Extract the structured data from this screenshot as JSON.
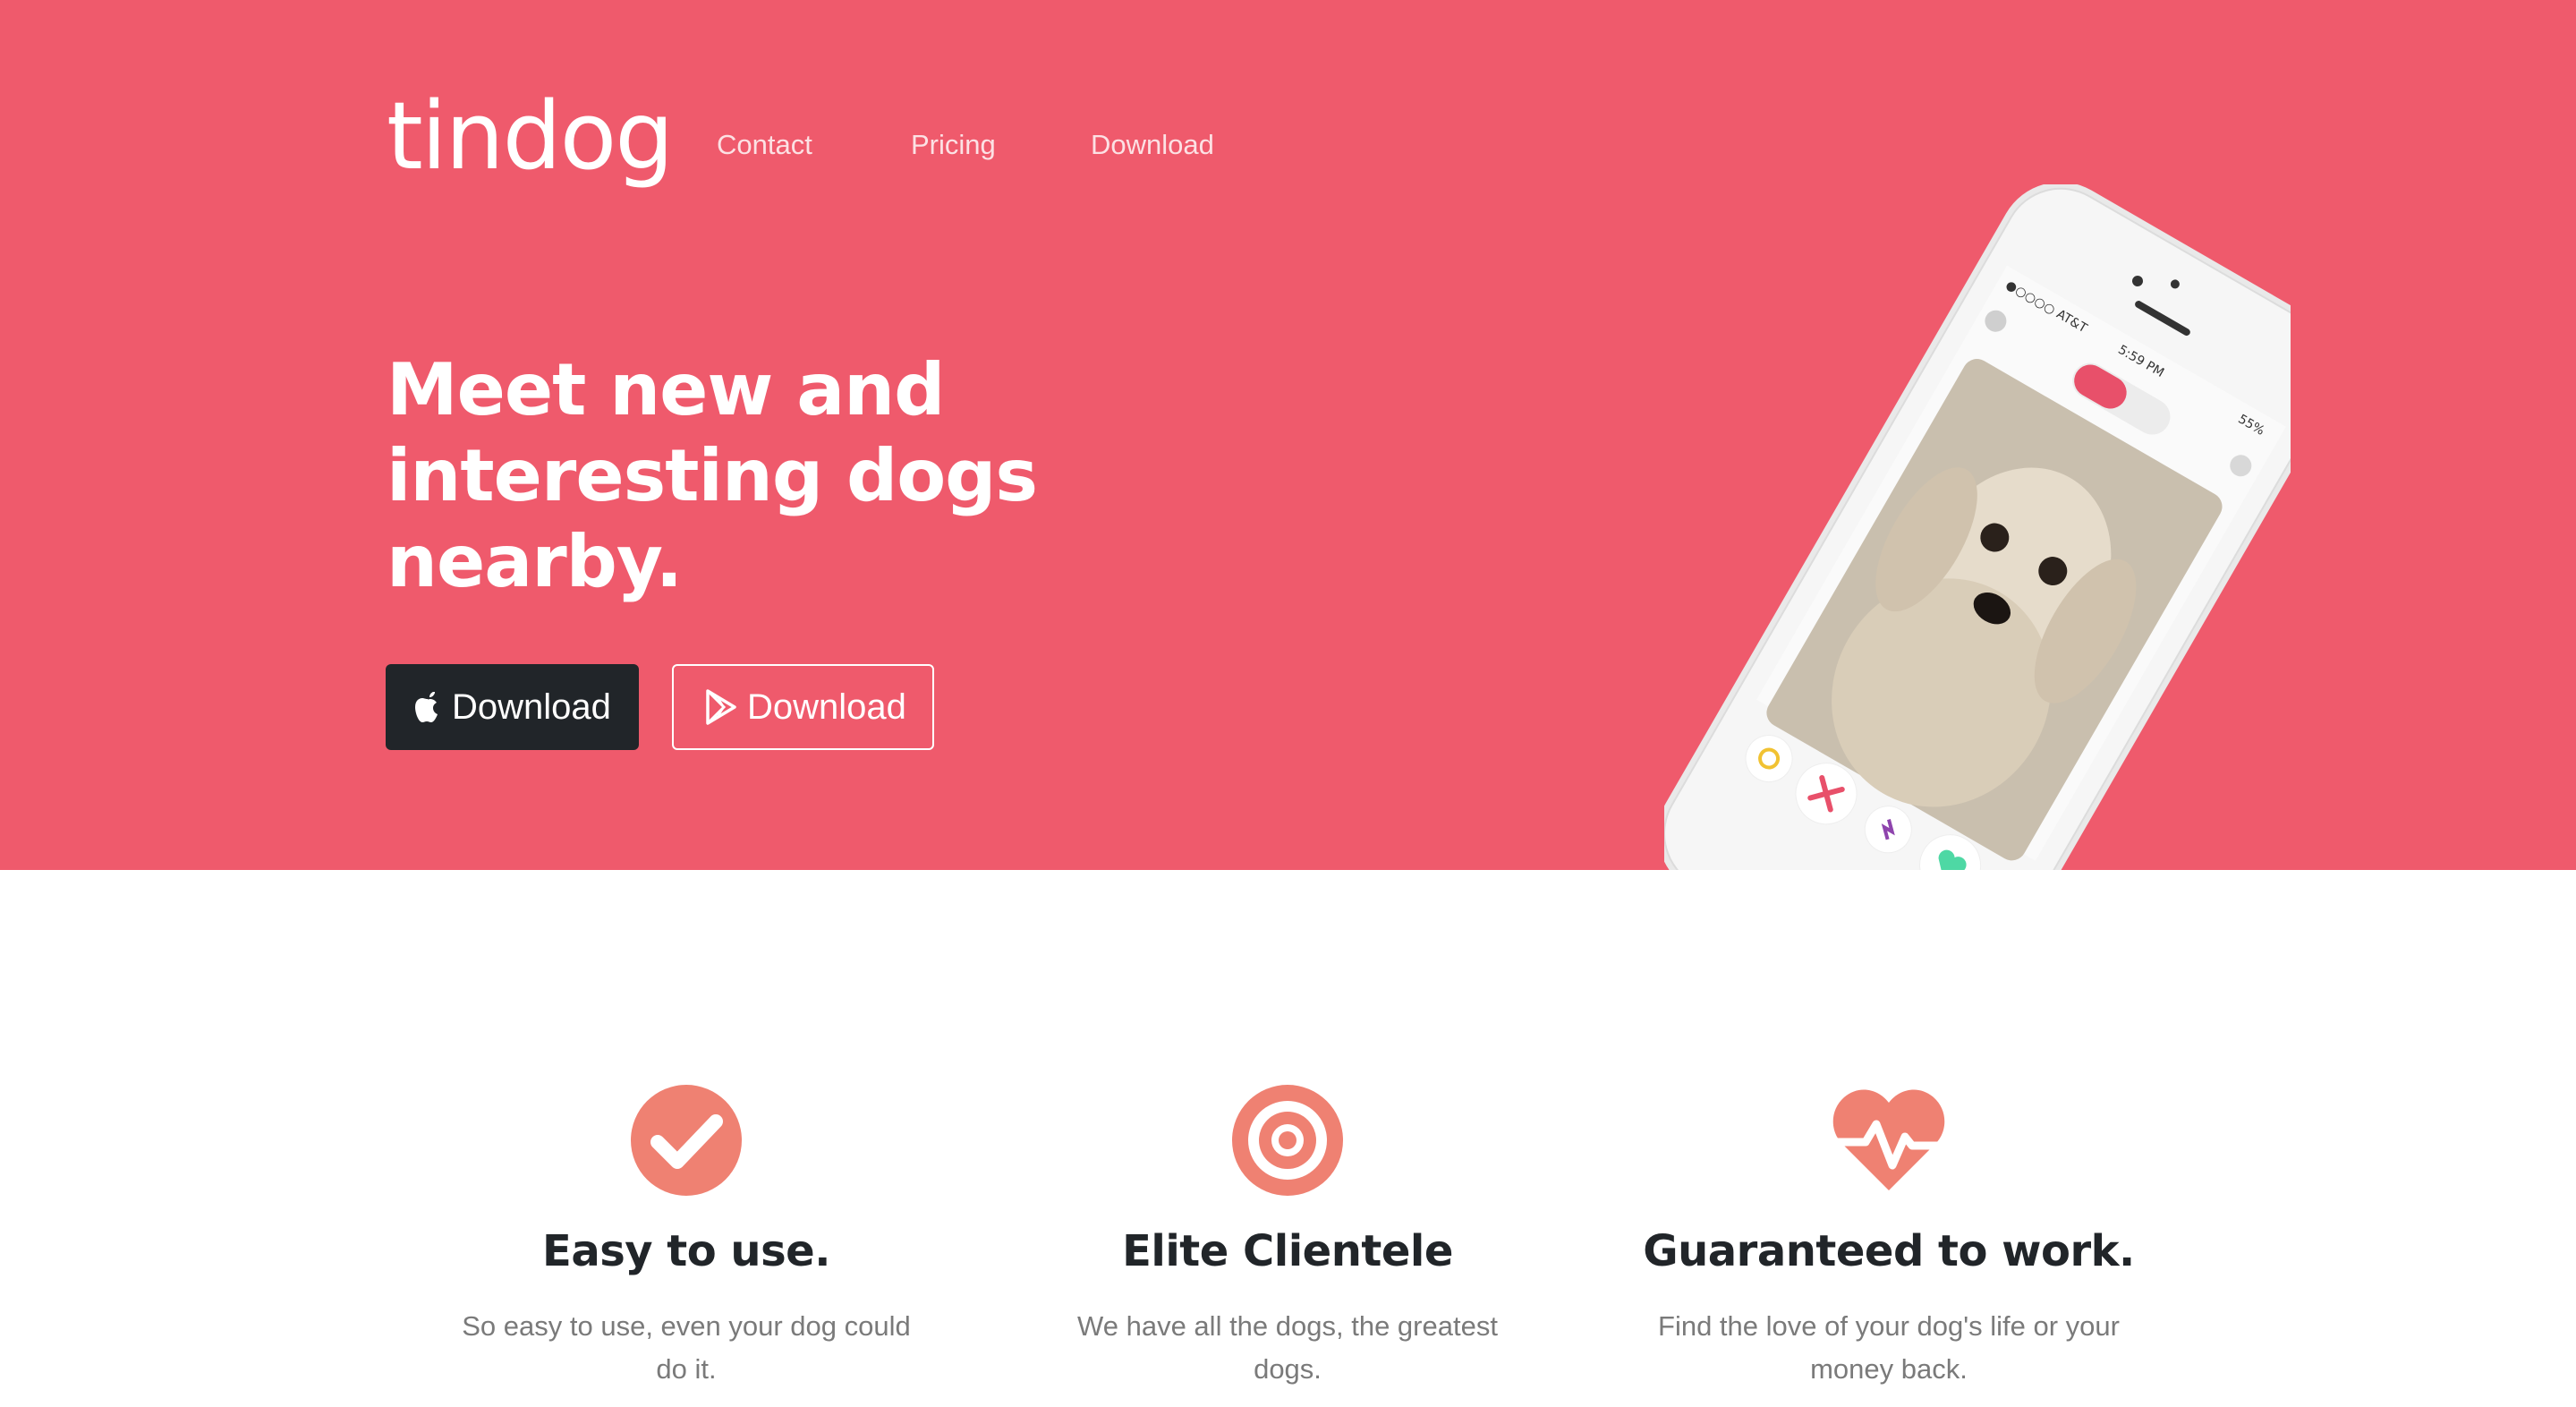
{
  "nav": {
    "brand": "tindog",
    "links": [
      "Contact",
      "Pricing",
      "Download"
    ]
  },
  "hero": {
    "headline": "Meet new and interesting dogs nearby.",
    "buttons": [
      {
        "label": "Download",
        "icon": "apple-icon"
      },
      {
        "label": "Download",
        "icon": "google-play-icon"
      }
    ],
    "phone": {
      "carrier": "●○○○○ AT&T",
      "time": "5:59 PM",
      "battery": "55%"
    }
  },
  "features": [
    {
      "icon": "check-circle-icon",
      "title": "Easy to use.",
      "text": "So easy to use, even your dog could do it."
    },
    {
      "icon": "bullseye-icon",
      "title": "Elite Clientele",
      "text": "We have all the dogs, the greatest dogs."
    },
    {
      "icon": "heartbeat-icon",
      "title": "Guaranteed to work.",
      "text": "Find the love of your dog's life or your money back."
    }
  ],
  "colors": {
    "hero_bg": "#ef5a6c",
    "feature_icon": "#ef8172",
    "dark_button": "#212529"
  }
}
